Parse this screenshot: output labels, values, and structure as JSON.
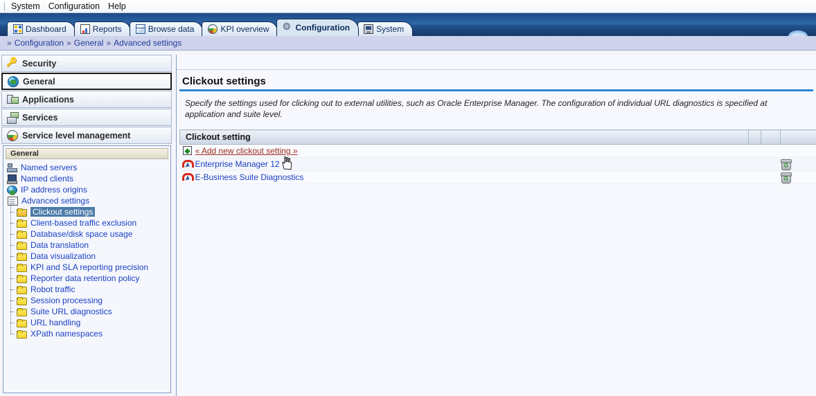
{
  "menubar": {
    "items": [
      {
        "label": "System"
      },
      {
        "label": "Configuration"
      },
      {
        "label": "Help"
      }
    ]
  },
  "tabs": [
    {
      "label": "Dashboard",
      "icon": "dashboard-icon",
      "active": false
    },
    {
      "label": "Reports",
      "icon": "report-icon",
      "active": false
    },
    {
      "label": "Browse data",
      "icon": "cube-icon",
      "active": false
    },
    {
      "label": "KPI overview",
      "icon": "gauge-icon",
      "active": false
    },
    {
      "label": "Configuration",
      "icon": "gear-icon",
      "active": true
    },
    {
      "label": "System",
      "icon": "monitor-icon",
      "active": false
    }
  ],
  "breadcrumb": {
    "separator": "»",
    "items": [
      {
        "label": "Configuration"
      },
      {
        "label": "General"
      },
      {
        "label": "Advanced settings"
      }
    ]
  },
  "sidebar": {
    "groups": [
      {
        "label": "Security",
        "icon": "key-icon",
        "selected": false
      },
      {
        "label": "General",
        "icon": "globe-icon",
        "selected": true
      },
      {
        "label": "Applications",
        "icon": "applications-icon",
        "selected": false
      },
      {
        "label": "Services",
        "icon": "services-icon",
        "selected": false
      },
      {
        "label": "Service level management",
        "icon": "gauge-icon",
        "selected": false
      }
    ],
    "tree": {
      "header": "General",
      "nodes": [
        {
          "label": "Named servers",
          "icon": "named-servers-icon",
          "level": 0,
          "selected": false
        },
        {
          "label": "Named clients",
          "icon": "named-clients-icon",
          "level": 0,
          "selected": false
        },
        {
          "label": "IP address origins",
          "icon": "ip-address-origins-icon",
          "level": 0,
          "selected": false
        },
        {
          "label": "Advanced settings",
          "icon": "advanced-settings-icon",
          "level": 0,
          "selected": false
        },
        {
          "label": "Clickout settings",
          "icon": "folder-open-icon",
          "level": 1,
          "selected": true
        },
        {
          "label": "Client-based traffic exclusion",
          "icon": "folder-icon",
          "level": 1,
          "selected": false
        },
        {
          "label": "Database/disk space usage",
          "icon": "folder-icon",
          "level": 1,
          "selected": false
        },
        {
          "label": "Data translation",
          "icon": "folder-icon",
          "level": 1,
          "selected": false
        },
        {
          "label": "Data visualization",
          "icon": "folder-icon",
          "level": 1,
          "selected": false
        },
        {
          "label": "KPI and SLA reporting precision",
          "icon": "folder-icon",
          "level": 1,
          "selected": false
        },
        {
          "label": "Reporter data retention policy",
          "icon": "folder-icon",
          "level": 1,
          "selected": false
        },
        {
          "label": "Robot traffic",
          "icon": "folder-icon",
          "level": 1,
          "selected": false
        },
        {
          "label": "Session processing",
          "icon": "folder-icon",
          "level": 1,
          "selected": false
        },
        {
          "label": "Suite URL diagnostics",
          "icon": "folder-icon",
          "level": 1,
          "selected": false
        },
        {
          "label": "URL handling",
          "icon": "folder-icon",
          "level": 1,
          "selected": false
        },
        {
          "label": "XPath namespaces",
          "icon": "folder-icon",
          "level": 1,
          "selected": false
        }
      ]
    }
  },
  "main": {
    "title": "Clickout settings",
    "description": "Specify the settings used for clicking out to external utilities, such as Oracle Enterprise Manager. The configuration of individual URL diagnostics is specified at application and suite level.",
    "table": {
      "columns": [
        "Clickout setting",
        "",
        ""
      ],
      "add_row": {
        "label": "« Add new clickout setting »",
        "icon": "add-plus-icon"
      },
      "rows": [
        {
          "name": "Enterprise Manager 12",
          "icon": "clickout-icon",
          "delete_icon": "trash-icon"
        },
        {
          "name": "E-Business Suite Diagnostics",
          "icon": "clickout-icon",
          "delete_icon": "trash-icon"
        }
      ]
    }
  },
  "colors": {
    "tab_bar": "#2f68a8",
    "accent_underline": "#2b86d0",
    "breadcrumb_bg": "#cfd4ec",
    "link": "#1a3fc4",
    "add_link": "#9c2b1e",
    "selection": "#4b7ba8"
  }
}
